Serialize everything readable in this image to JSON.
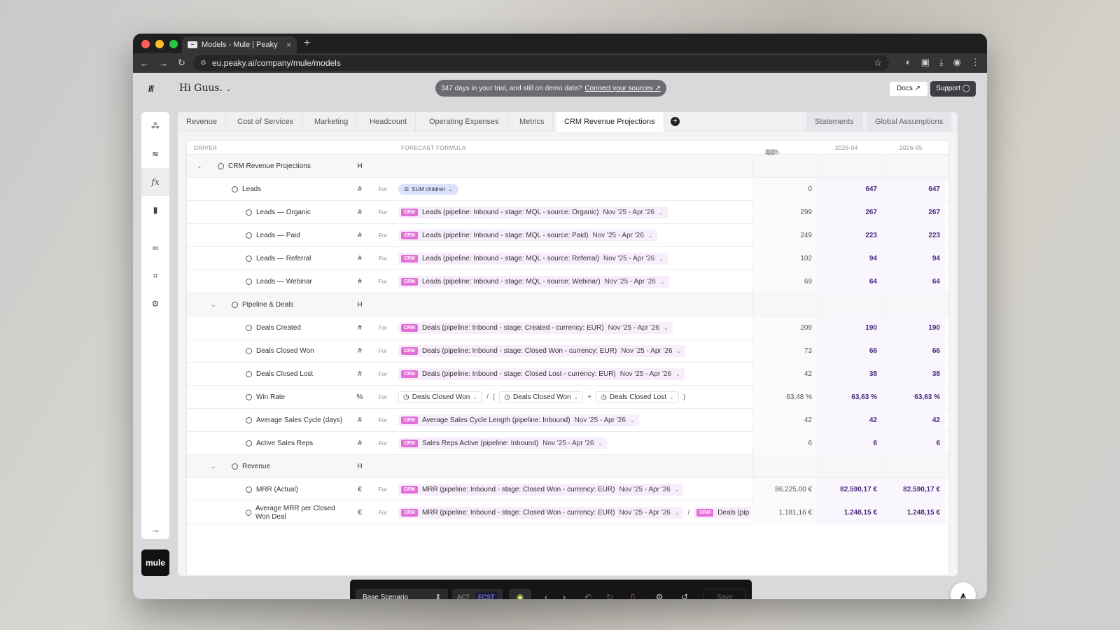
{
  "browser": {
    "tab_title": "Models - Mule | Peaky",
    "url": "eu.peaky.ai/company/mule/models"
  },
  "app": {
    "greeting": "Hi Guus.",
    "banner_text": "347 days in your trial, and still on demo data?",
    "banner_link": "Connect your sources ↗",
    "docs_label": "Docs ↗",
    "support_label": "Support",
    "brand_label": "mule"
  },
  "tabs": [
    "Revenue",
    "Cost of Services",
    "Marketing",
    "Headcount",
    "Operating Expenses",
    "Metrics",
    "CRM Revenue Projections"
  ],
  "tabs_right": [
    "Statements",
    "Global Assumptions"
  ],
  "columns": {
    "driver": "DRIVER",
    "formula": "FORECAST FORMULA",
    "lc": "LC",
    "p1": "2026-03",
    "p2": "2026-04",
    "p3": "2026-05"
  },
  "for_label": "For",
  "rows": [
    {
      "name": "CRM Revenue Projections",
      "unit": "H",
      "level": 0,
      "group": true
    },
    {
      "name": "Leads",
      "unit": "#",
      "level": 1,
      "chip": "SUM children",
      "v": [
        "0",
        "647",
        "647"
      ]
    },
    {
      "name": "Leads — Organic",
      "unit": "#",
      "level": 2,
      "crm": "Leads (pipeline: Inbound - stage: MQL - source: Organic)",
      "range": "Nov '25 - Apr '26",
      "v": [
        "299",
        "267",
        "267"
      ]
    },
    {
      "name": "Leads — Paid",
      "unit": "#",
      "level": 2,
      "crm": "Leads (pipeline: Inbound - stage: MQL - source: Paid)",
      "range": "Nov '25 - Apr '26",
      "v": [
        "249",
        "223",
        "223"
      ]
    },
    {
      "name": "Leads — Referral",
      "unit": "#",
      "level": 2,
      "crm": "Leads (pipeline: Inbound - stage: MQL - source: Referral)",
      "range": "Nov '25 - Apr '26",
      "v": [
        "102",
        "94",
        "94"
      ]
    },
    {
      "name": "Leads — Webinar",
      "unit": "#",
      "level": 2,
      "crm": "Leads (pipeline: Inbound - stage: MQL - source: Webinar)",
      "range": "Nov '25 - Apr '26",
      "v": [
        "69",
        "64",
        "64"
      ]
    },
    {
      "name": "Pipeline & Deals",
      "unit": "H",
      "level": 1,
      "group": true
    },
    {
      "name": "Deals Created",
      "unit": "#",
      "level": 2,
      "crm": "Deals (pipeline: Inbound - stage: Created - currency: EUR)",
      "range": "Nov '25 - Apr '26",
      "v": [
        "209",
        "190",
        "190"
      ]
    },
    {
      "name": "Deals Closed Won",
      "unit": "#",
      "level": 2,
      "crm": "Deals (pipeline: Inbound - stage: Closed Won - currency: EUR)",
      "range": "Nov '25 - Apr '26",
      "v": [
        "73",
        "66",
        "66"
      ]
    },
    {
      "name": "Deals Closed Lost",
      "unit": "#",
      "level": 2,
      "crm": "Deals (pipeline: Inbound - stage: Closed Lost - currency: EUR)",
      "range": "Nov '25 - Apr '26",
      "v": [
        "42",
        "38",
        "38"
      ]
    },
    {
      "name": "Win Rate",
      "unit": "%",
      "level": 2,
      "refs": [
        "Deals Closed Won",
        "/",
        "(",
        "Deals Closed Won",
        "+",
        "Deals Closed Lost",
        ")"
      ],
      "v": [
        "63,48 %",
        "63,63 %",
        "63,63 %"
      ]
    },
    {
      "name": "Average Sales Cycle (days)",
      "unit": "#",
      "level": 2,
      "crm": "Average Sales Cycle Length (pipeline: Inbound)",
      "range": "Nov '25 - Apr '26",
      "v": [
        "42",
        "42",
        "42"
      ]
    },
    {
      "name": "Active Sales Reps",
      "unit": "#",
      "level": 2,
      "crm": "Sales Reps Active (pipeline: Inbound)",
      "range": "Nov '25 - Apr '26",
      "v": [
        "6",
        "6",
        "6"
      ]
    },
    {
      "name": "Revenue",
      "unit": "H",
      "level": 1,
      "group": true
    },
    {
      "name": "MRR (Actual)",
      "unit": "€",
      "level": 2,
      "crm": "MRR (pipeline: Inbound - stage: Closed Won - currency: EUR)",
      "range": "Nov '25 - Apr '26",
      "v": [
        "86.225,00 €",
        "82.590,17 €",
        "82.590,17 €"
      ]
    },
    {
      "name": "Average MRR per Closed Won Deal",
      "unit": "€",
      "level": 2,
      "crm": "MRR (pipeline: Inbound - stage: Closed Won - currency: EUR)",
      "range": "Nov '25 - Apr '26",
      "extra": "Deals (pip",
      "v": [
        "1.181,16 €",
        "1.248,15 €",
        "1.248,15 €"
      ]
    }
  ],
  "toolbar": {
    "scenario": "Base Scenario",
    "act": "ACT",
    "fcst": "FCST",
    "save": "Save"
  },
  "colors": {
    "crm_badge": "#e46fd9",
    "forecast_value": "#4b2a7e",
    "fcst_active": "#8d8cff",
    "eye_icon": "#d6f36a"
  }
}
